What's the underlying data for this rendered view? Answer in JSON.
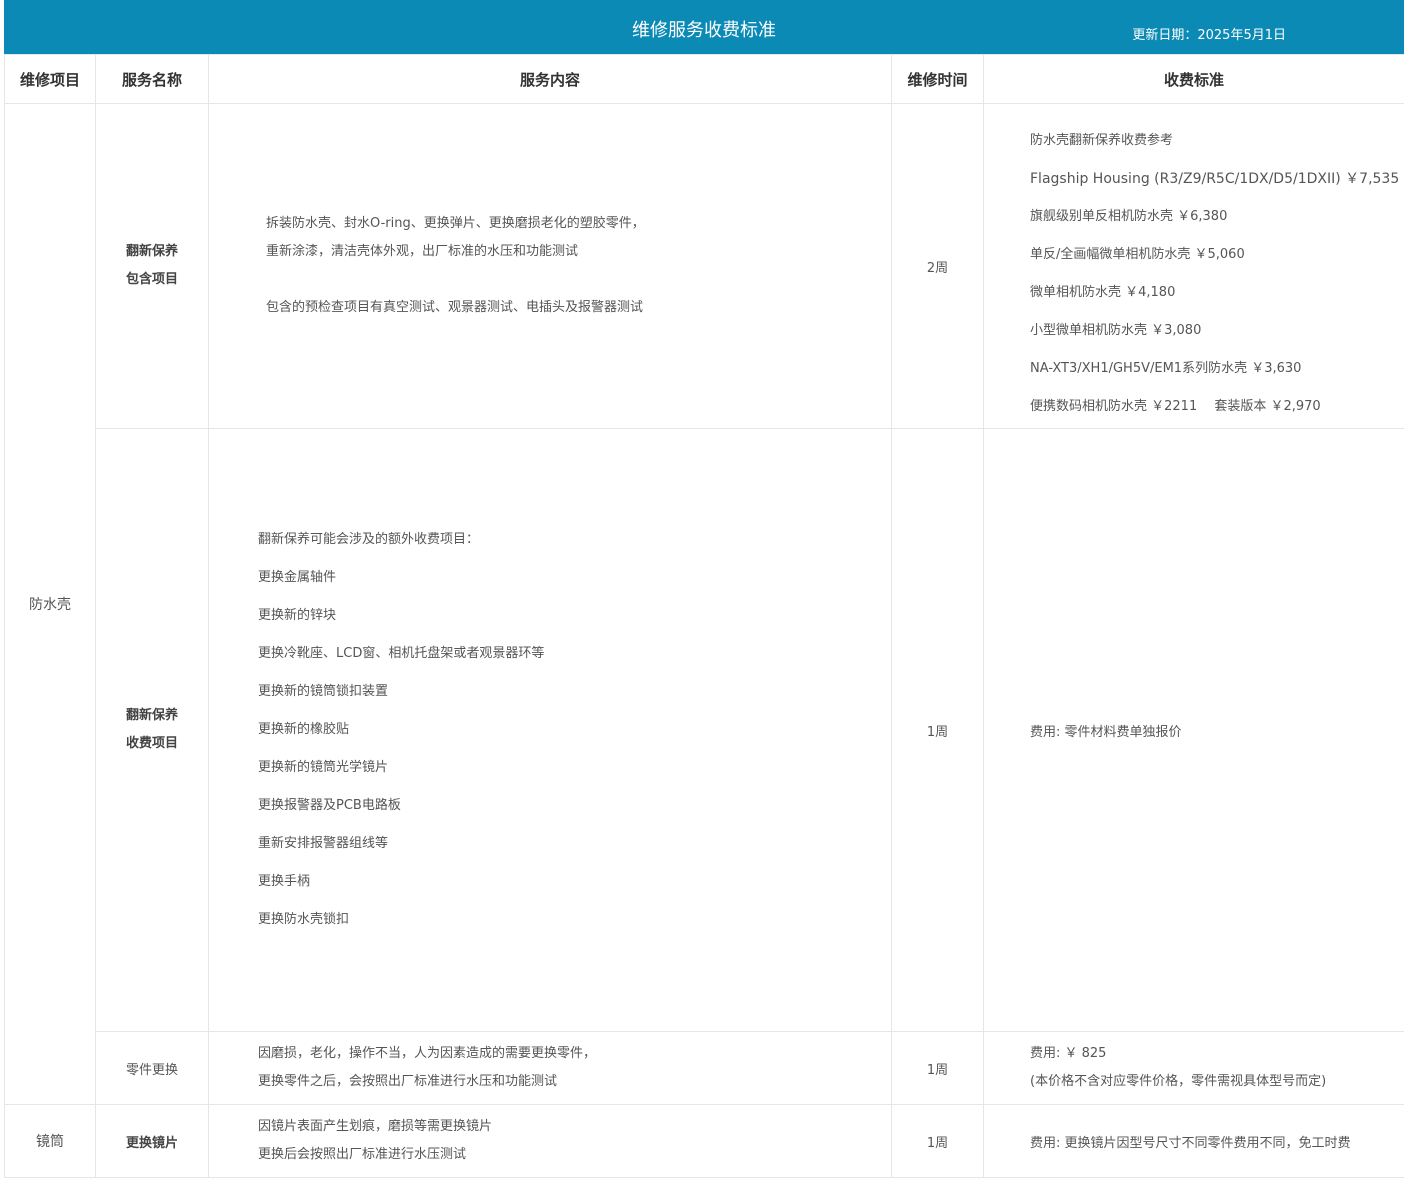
{
  "header": {
    "title": "维修服务收费标准",
    "date_label": "更新日期：2025年5月1日"
  },
  "columns": {
    "item": "维修项目",
    "name": "服务名称",
    "content": "服务内容",
    "time": "维修时间",
    "fee": "收费标准"
  },
  "rows": [
    {
      "item": "防水壳",
      "name_line1": "翻新保养",
      "name_line2": "包含项目",
      "content": [
        "拆装防水壳、封水O-ring、更换弹片、更换磨损老化的塑胶零件，",
        "重新涂漆，清洁壳体外观，出厂标准的水压和功能测试",
        "包含的预检查项目有真空测试、观景器测试、电插头及报警器测试"
      ],
      "time": "2周",
      "fee": [
        "防水壳翻新保养收费参考",
        "Flagship Housing (R3/Z9/R5C/1DX/D5/1DXII) ￥7,535",
        "旗舰级别单反相机防水壳 ￥6,380",
        "单反/全画幅微单相机防水壳 ￥5,060",
        "微单相机防水壳 ￥4,180",
        "小型微单相机防水壳 ￥3,080",
        "NA-XT3/XH1/GH5V/EM1系列防水壳 ￥3,630",
        "便携数码相机防水壳 ￥2211　 套装版本 ￥2,970"
      ]
    },
    {
      "name_line1": "翻新保养",
      "name_line2": "收费项目",
      "content": [
        "翻新保养可能会涉及的额外收费项目：",
        "更换金属轴件",
        "更换新的锌块",
        "更换冷靴座、LCD窗、相机托盘架或者观景器环等",
        "更换新的镜筒锁扣装置",
        "更换新的橡胶贴",
        "更换新的镜筒光学镜片",
        "更换报警器及PCB电路板",
        "重新安排报警器组线等",
        "更换手柄",
        "更换防水壳锁扣"
      ],
      "time": "1周",
      "fee": "费用: 零件材料费单独报价"
    },
    {
      "name": "零件更换",
      "content": [
        "因磨损，老化，操作不当，人为因素造成的需要更换零件，",
        "更换零件之后，会按照出厂标准进行水压和功能测试"
      ],
      "time": "1周",
      "fee": [
        "费用: ￥ 825",
        "(本价格不含对应零件价格，零件需视具体型号而定)"
      ]
    },
    {
      "item": "镜筒",
      "name": "更换镜片",
      "content": [
        "因镜片表面产生划痕，磨损等需更换镜片",
        "更换后会按照出厂标准进行水压测试"
      ],
      "time": "1周",
      "fee": "费用: 更换镜片因型号尺寸不同零件费用不同，免工时费"
    }
  ]
}
